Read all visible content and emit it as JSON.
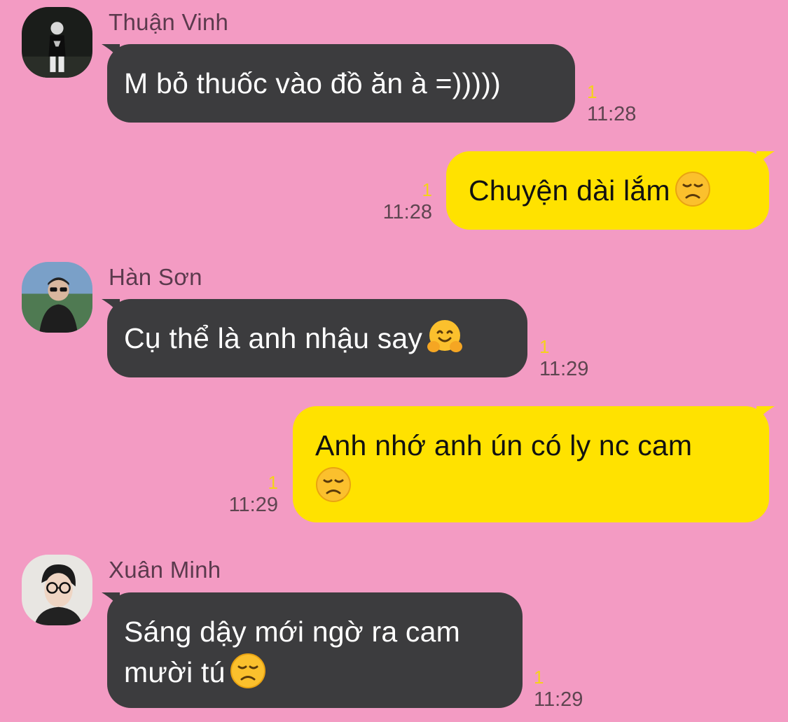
{
  "messages": [
    {
      "type": "incoming",
      "sender": "Thuận Vinh",
      "text": "M bỏ thuốc vào đồ ăn à =)))))",
      "emoji": "",
      "unread": "1",
      "time": "11:28",
      "avatar": "avatar-thuan-vinh"
    },
    {
      "type": "outgoing",
      "text": "Chuyện dài lắm",
      "emoji": "disappointed-face",
      "unread": "1",
      "time": "11:28"
    },
    {
      "type": "incoming",
      "sender": "Hàn Sơn",
      "text": "Cụ thể là anh nhậu say",
      "emoji": "hugging-face",
      "unread": "1",
      "time": "11:29",
      "avatar": "avatar-han-son"
    },
    {
      "type": "outgoing",
      "text": "Anh nhớ anh ún có ly nc cam",
      "emoji": "disappointed-face",
      "unread": "1",
      "time": "11:29"
    },
    {
      "type": "incoming",
      "sender": "Xuân Minh",
      "text": "Sáng dậy mới ngờ ra cam mười tú",
      "emoji": "disappointed-face",
      "unread": "1",
      "time": "11:29",
      "avatar": "avatar-xuan-minh"
    }
  ],
  "colors": {
    "background": "#f39bc3",
    "incoming_bubble": "#3c3c3e",
    "outgoing_bubble": "#ffe200",
    "unread": "#f4d21a",
    "time": "#5e4550"
  }
}
